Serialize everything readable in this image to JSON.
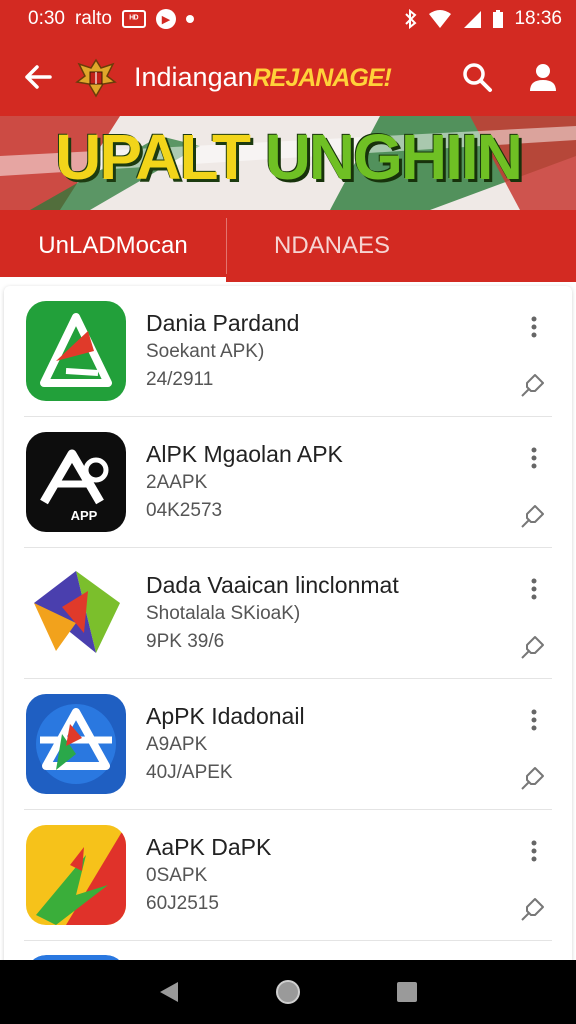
{
  "status_bar": {
    "time_left": "0:30",
    "carrier": "ralto",
    "badge": "ᴴᴰ",
    "circle_glyph": "▶",
    "time_right": "18:36"
  },
  "app_bar": {
    "title_plain": "Indiangan",
    "title_accent": "REJANAGE!"
  },
  "banner": {
    "part1": "UPALT",
    "part2": "UNGHIIN"
  },
  "tabs": [
    {
      "label": "UnLADMocan"
    },
    {
      "label": "NDANAES"
    }
  ],
  "apps": [
    {
      "name": "Dania Pardand",
      "sub": "Soekant APK)",
      "meta": "24/2911"
    },
    {
      "name": "AlPK Mgaolan APK",
      "sub": "2AAPK",
      "meta": "04K2573"
    },
    {
      "name": "Dada Vaaican linclonmat",
      "sub": "Shotalala SKioaK)",
      "meta": "9PK 39/6"
    },
    {
      "name": "ApPK Idadonail",
      "sub": "A9APK",
      "meta": "40J/APEK"
    },
    {
      "name": "AaPK DaPK",
      "sub": "0SAPK",
      "meta": "60J2515"
    }
  ],
  "apps_app2_icon_text": "APP",
  "colors": {
    "primary": "#d32a22",
    "accent": "#ffd23a"
  }
}
